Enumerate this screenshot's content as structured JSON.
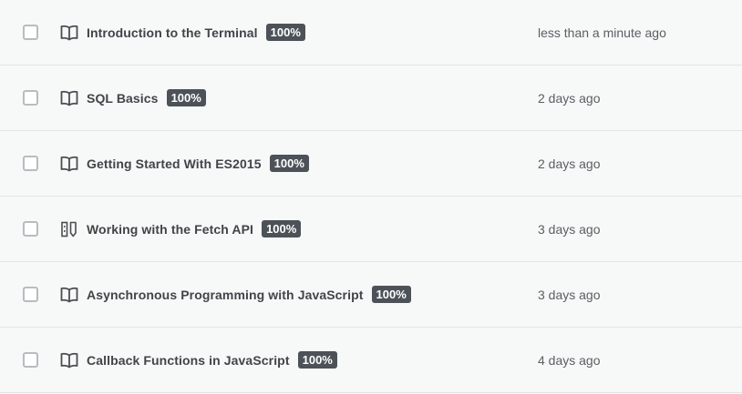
{
  "items": [
    {
      "title": "Introduction to the Terminal",
      "badge": "100%",
      "time": "less than a minute ago",
      "icon": "book-icon"
    },
    {
      "title": "SQL Basics",
      "badge": "100%",
      "time": "2 days ago",
      "icon": "book-icon"
    },
    {
      "title": "Getting Started With ES2015",
      "badge": "100%",
      "time": "2 days ago",
      "icon": "book-icon"
    },
    {
      "title": "Working with the Fetch API",
      "badge": "100%",
      "time": "3 days ago",
      "icon": "workshop-icon"
    },
    {
      "title": "Asynchronous Programming with JavaScript",
      "badge": "100%",
      "time": "3 days ago",
      "icon": "book-icon"
    },
    {
      "title": "Callback Functions in JavaScript",
      "badge": "100%",
      "time": "4 days ago",
      "icon": "book-icon"
    }
  ],
  "colors": {
    "background": "#f7f8f8",
    "badge_bg": "#4c5258",
    "badge_text": "#ffffff",
    "divider": "#e2e4e5"
  }
}
